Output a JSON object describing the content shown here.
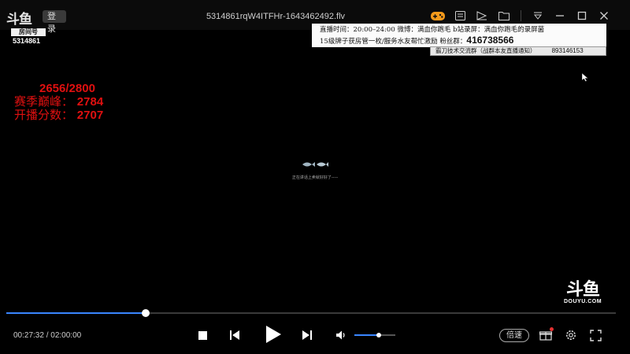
{
  "titlebar": {
    "logo": "斗鱼",
    "login_label": "登录",
    "file_name": "5314861rqW4ITFHr-1643462492.flv"
  },
  "room": {
    "badge": "房间号",
    "number": "5314861"
  },
  "notice": {
    "line1": "直播时间：20:00–24:00 微博：满血你跑毛 b站录屏：满血你跑毛的录屏菌",
    "line2_text": "15级牌子获房管一枚/服务水友帮忙激励 粉丝群：",
    "line2_number": "416738566",
    "group_text": "霸刀技术交流群（战群本友直播通知）",
    "group_number": "893146153"
  },
  "stats": {
    "progress": "2656/2800",
    "peak_label": "赛季巅峰：",
    "peak_value": "2784",
    "start_label": "开播分数：",
    "start_value": "2707"
  },
  "loader": {
    "icon": "fish-icon",
    "text": "正在讲话上卖就好好了-----"
  },
  "watermark": {
    "logo": "斗鱼",
    "text": "DOUYU.COM"
  },
  "player": {
    "progress_fraction": 0.2289,
    "current_time": "00:27:32",
    "time_sep": "/",
    "total_time": "02:00:00",
    "volume_fraction": 0.6,
    "speed_label": "倍速",
    "accent": "#3a86ff"
  },
  "icons": {
    "gamepad": "gamepad-icon",
    "chat": "chat-icon",
    "pip": "picture-in-picture-icon",
    "folder": "folder-icon",
    "dropdown": "dropdown-icon",
    "minimize": "minimize-icon",
    "maximize": "maximize-icon",
    "close": "close-icon"
  }
}
